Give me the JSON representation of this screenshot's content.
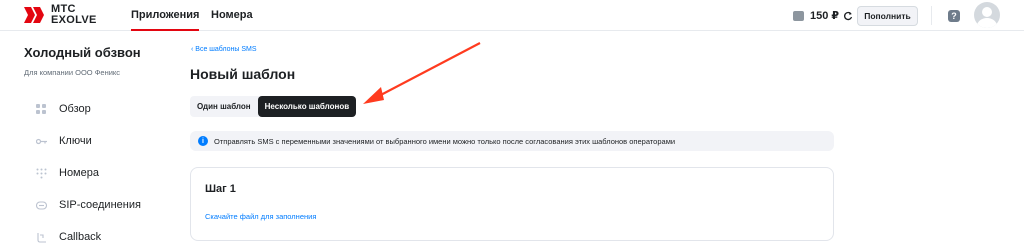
{
  "header": {
    "logo_text_line1": "МТС",
    "logo_text_line2": "EXOLVE",
    "nav": [
      "Приложения",
      "Номера"
    ],
    "balance": "150 ₽",
    "topup_label": "Пополнить",
    "help_label": "?"
  },
  "sidebar": {
    "title": "Холодный обзвон",
    "subtitle": "Для компании ООО Феникс",
    "items": [
      {
        "label": "Обзор",
        "icon": "grid-icon"
      },
      {
        "label": "Ключи",
        "icon": "key-icon"
      },
      {
        "label": "Номера",
        "icon": "dialpad-icon"
      },
      {
        "label": "SIP-соединения",
        "icon": "sip-icon"
      },
      {
        "label": "Callback",
        "icon": "callback-icon"
      }
    ]
  },
  "main": {
    "breadcrumb": "Все шаблоны SMS",
    "title": "Новый шаблон",
    "tabs": [
      "Один шаблон",
      "Несколько шаблонов"
    ],
    "active_tab": "Несколько шаблонов",
    "info_text": "Отправлять SMS с переменными значениями от выбранного имени можно только после согласования этих шаблонов операторами",
    "step_title": "Шаг 1",
    "download_link": "Скачайте файл для заполнения"
  },
  "colors": {
    "accent": "#e30611",
    "link": "#007cff",
    "dark": "#1d2023",
    "annotation_arrow": "#ff3b1f"
  }
}
